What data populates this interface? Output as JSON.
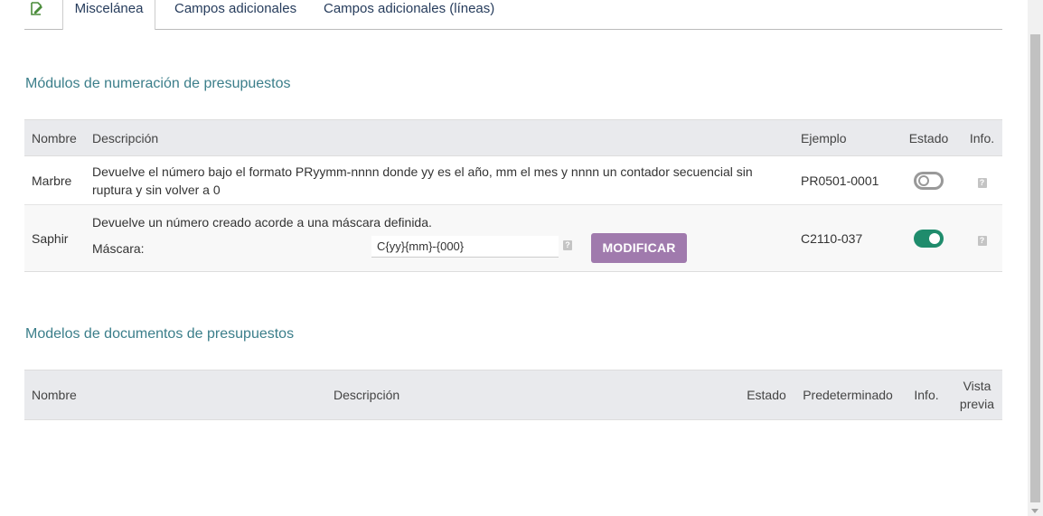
{
  "tabs": {
    "active": "Miscelánea",
    "extra_fields": "Campos adicionales",
    "extra_fields_lines": "Campos adicionales (líneas)"
  },
  "numbering": {
    "title": "Módulos de numeración de presupuestos",
    "headers": {
      "name": "Nombre",
      "description": "Descripción",
      "example": "Ejemplo",
      "status": "Estado",
      "info": "Info."
    },
    "rows": [
      {
        "name": "Marbre",
        "description": "Devuelve el número bajo el formato PRyymm-nnnn donde yy es el año, mm el mes y nnnn un contador secuencial sin ruptura y sin volver a 0",
        "example": "PR0501-0001",
        "enabled": false
      },
      {
        "name": "Saphir",
        "description": "Devuelve un número creado acorde a una máscara definida.",
        "mask_label": "Máscara:",
        "mask_value": "C{yy}{mm}-{000}",
        "modify_label": "MODIFICAR",
        "example": "C2110-037",
        "enabled": true
      }
    ]
  },
  "models": {
    "title": "Modelos de documentos de presupuestos",
    "headers": {
      "name": "Nombre",
      "description": "Descripción",
      "status": "Estado",
      "default": "Predeterminado",
      "info": "Info.",
      "preview_line1": "Vista",
      "preview_line2": "previa"
    }
  },
  "icons": {
    "tab_icon": "edit-document-icon",
    "help": "question-icon",
    "help_glyph": "?"
  },
  "colors": {
    "section_title": "#3b7e8a",
    "toggle_on": "#1f8c6c",
    "button": "#a07aad",
    "header_bg": "#e9eaed"
  }
}
